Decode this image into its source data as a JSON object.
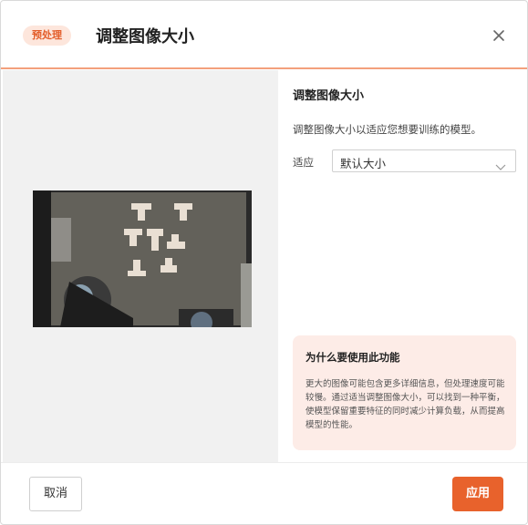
{
  "header": {
    "badge": "预处理",
    "title": "调整图像大小",
    "close_icon": "close-icon"
  },
  "preview": {
    "image_alt": "image-preview"
  },
  "panel": {
    "section_title": "调整图像大小",
    "description": "调整图像大小以适应您想要训练的模型。",
    "fit_label": "适应",
    "fit_value": "默认大小",
    "dropdown_icon": "chevron-down-icon"
  },
  "info": {
    "title": "为什么要使用此功能",
    "text": "更大的图像可能包含更多详细信息，但处理速度可能较慢。通过适当调整图像大小，可以找到一种平衡，使模型保留重要特征的同时减少计算负载，从而提高模型的性能。"
  },
  "footer": {
    "cancel_label": "取消",
    "apply_label": "应用"
  },
  "colors": {
    "accent": "#e8622c",
    "badge_bg": "#fde6dc",
    "info_bg": "#fdece7",
    "header_rule": "#f3a07c"
  }
}
